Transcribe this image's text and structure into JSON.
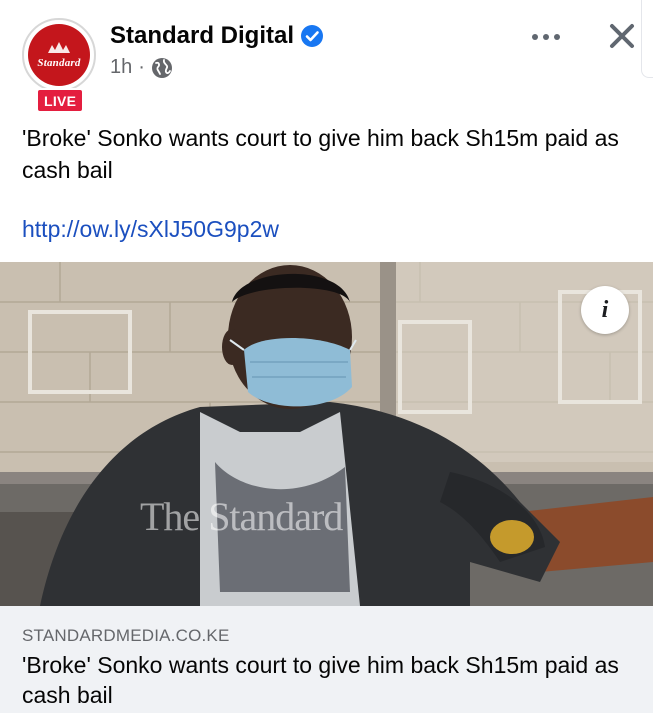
{
  "header": {
    "avatar_text": "Standard",
    "live_label": "LIVE",
    "page_name": "Standard Digital",
    "time": "1h",
    "separator": "·"
  },
  "post": {
    "text": "'Broke' Sonko wants court to give him back Sh15m paid as cash bail",
    "link": "http://ow.ly/sXlJ50G9p2w"
  },
  "image": {
    "watermark": "The Standard",
    "info_label": "i"
  },
  "preview": {
    "domain": "STANDARDMEDIA.CO.KE",
    "title": "'Broke' Sonko wants court to give him back Sh15m paid as cash bail"
  },
  "icons": {
    "verified": "verified-badge-icon",
    "audience": "globe-icon",
    "more": "more-options-icon",
    "close": "close-icon"
  },
  "colors": {
    "brand_red": "#c4161c",
    "live_red": "#e41e3f",
    "verified_blue": "#1877f2",
    "link_blue": "#1b4fbf",
    "secondary_text": "#65676b",
    "preview_bg": "#f0f2f5"
  }
}
